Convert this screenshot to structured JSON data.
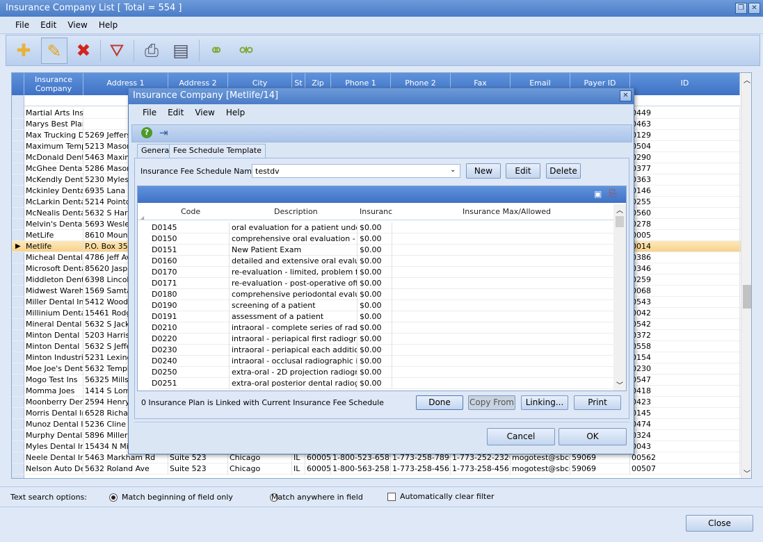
{
  "window": {
    "title": "Insurance Company List [ Total = 554 ]",
    "restore_icon": "restore-icon",
    "close_icon": "close-icon"
  },
  "menu": [
    "File",
    "Edit",
    "View",
    "Help"
  ],
  "toolbar": {
    "icons": [
      "add-icon",
      "edit-icon",
      "delete-icon",
      "clear-filter-icon",
      "print-icon",
      "print-list-icon",
      "link-icon",
      "unlink-icon"
    ]
  },
  "grid": {
    "columns": [
      "Insurance Company",
      "Address 1",
      "Address 2",
      "City",
      "St",
      "Zip",
      "Phone 1",
      "Phone 2",
      "Fax",
      "Email",
      "Payer ID",
      "ID"
    ],
    "rows": [
      {
        "name": "Martial Arts Ins",
        "addr": "",
        "id": "0449"
      },
      {
        "name": "Marys Best Plan",
        "addr": "",
        "id": "0463"
      },
      {
        "name": "Max Trucking D",
        "addr": "5269 Jeffers",
        "id": "0129"
      },
      {
        "name": "Maximum Temp",
        "addr": "5213 Mason",
        "id": "0504"
      },
      {
        "name": "McDonald Dent",
        "addr": "5463 Maxine",
        "id": "0290"
      },
      {
        "name": "McGhee Dental",
        "addr": "5286 Mason",
        "id": "0377"
      },
      {
        "name": "McKendly Denta",
        "addr": "5230 Myles",
        "id": "0363"
      },
      {
        "name": "Mckinley Dental",
        "addr": "6935 Lana A",
        "id": "0146"
      },
      {
        "name": "McLarkin Dental",
        "addr": "5214 Pointd",
        "id": "0255"
      },
      {
        "name": "McNealis Dental",
        "addr": "5632 S Harri",
        "id": "0560"
      },
      {
        "name": "Melvin's Dental",
        "addr": "5693 Wesley",
        "id": "0278"
      },
      {
        "name": "MetLife",
        "addr": "8610 Mounti",
        "id": "0005"
      },
      {
        "name": "Metlife",
        "addr": "P.O. Box 350",
        "id": "0014"
      },
      {
        "name": "Micheal Dental I",
        "addr": "4786 Jeff Av",
        "id": "0386"
      },
      {
        "name": "Microsoft Dental",
        "addr": "85620 Jaspe",
        "id": "0346"
      },
      {
        "name": "Middleton Dent",
        "addr": "6398 Lincoln",
        "id": "0259"
      },
      {
        "name": "Midwest Wareh",
        "addr": "1569 Samtag",
        "id": "0068"
      },
      {
        "name": "Miller Dental In",
        "addr": "5412 Woods",
        "id": "0543"
      },
      {
        "name": "Millinium Dental",
        "addr": "15461 Rodg",
        "id": "0042"
      },
      {
        "name": "Mineral Dental I",
        "addr": "5632 S Jacks",
        "id": "0542"
      },
      {
        "name": "Minton Dental I",
        "addr": "5203 Harris",
        "id": "0372"
      },
      {
        "name": "Minton Dental I",
        "addr": "5632 S Jeffe",
        "id": "0558"
      },
      {
        "name": "Minton Industri",
        "addr": "5231 Lexing",
        "id": "0154"
      },
      {
        "name": "Moe Joe's Dent",
        "addr": "5632 Temple",
        "id": "0230"
      },
      {
        "name": "Mogo Test Ins",
        "addr": "56325 Millsi",
        "id": "0547"
      },
      {
        "name": "Momma Joes",
        "addr": "1414 S Lomb",
        "id": "0418"
      },
      {
        "name": "Moonberry Dent",
        "addr": "2594 Henry",
        "id": "0423"
      },
      {
        "name": "Morris Dental In",
        "addr": "6528 Richard",
        "id": "0145"
      },
      {
        "name": "Munoz Dental I",
        "addr": "5236 Cline A",
        "id": "0474"
      },
      {
        "name": "Murphy Dental I",
        "addr": "5896 Miller A",
        "id": "0324"
      },
      {
        "name": "Myles Dental In",
        "addr": "15434 N Mic",
        "id": "0043"
      }
    ],
    "full_rows": [
      {
        "name": "Neele Dental In",
        "addr1": "5463 Markham Rd",
        "addr2": "Suite 523",
        "city": "Chicago",
        "st": "IL",
        "zip": "60005",
        "phone1": "1-800-523-6589",
        "phone2": "1-773-258-7896",
        "fax": "1-773-252-2320",
        "email": "mogotest@sbcg",
        "payer": "59069",
        "id": "00562"
      },
      {
        "name": "Nelson Auto De",
        "addr1": "5632 Roland Ave",
        "addr2": "Suite 523",
        "city": "Chicago",
        "st": "IL",
        "zip": "60005",
        "phone1": "1-800-563-2587",
        "phone2": "1-773-258-4563",
        "fax": "1-773-258-4561",
        "email": "mogotest@sbcg",
        "payer": "59069",
        "id": "00507"
      }
    ]
  },
  "search": {
    "label": "Text search options:",
    "opt1": "Match beginning of field only",
    "opt2": "Match anywhere in field",
    "opt3": "Automatically clear filter"
  },
  "close_button": "Close",
  "dialog": {
    "title": "Insurance Company [Metlife/14]",
    "menu": [
      "File",
      "Edit",
      "View",
      "Help"
    ],
    "tabs": [
      "General",
      "Fee Schedule Template"
    ],
    "fee_label": "Insurance Fee Schedule Name:",
    "fee_value": "testdv",
    "btn_new": "New",
    "btn_edit": "Edit",
    "btn_delete": "Delete",
    "columns": [
      "Code",
      "Description",
      "Insuranc",
      "Insurance Max/Allowed"
    ],
    "rows": [
      {
        "code": "D0145",
        "desc": "oral evaluation for a patient under",
        "amt": "$0.00"
      },
      {
        "code": "D0150",
        "desc": "comprehensive oral evaluation - ne",
        "amt": "$0.00"
      },
      {
        "code": "D0151",
        "desc": "New Patient Exam",
        "amt": "$0.00"
      },
      {
        "code": "D0160",
        "desc": "detailed and extensive oral evaluati",
        "amt": "$0.00"
      },
      {
        "code": "D0170",
        "desc": "re-evaluation - limited, problem foc",
        "amt": "$0.00"
      },
      {
        "code": "D0171",
        "desc": "re-evaluation - post-operative offic",
        "amt": "$0.00"
      },
      {
        "code": "D0180",
        "desc": "comprehensive periodontal evaluati",
        "amt": "$0.00"
      },
      {
        "code": "D0190",
        "desc": "screening of a patient",
        "amt": "$0.00"
      },
      {
        "code": "D0191",
        "desc": "assessment of a patient",
        "amt": "$0.00"
      },
      {
        "code": "D0210",
        "desc": "intraoral - complete series of radio",
        "amt": "$0.00"
      },
      {
        "code": "D0220",
        "desc": "intraoral - periapical first radiograp",
        "amt": "$0.00"
      },
      {
        "code": "D0230",
        "desc": "intraoral - periapical each additiona",
        "amt": "$0.00"
      },
      {
        "code": "D0240",
        "desc": "intraoral - occlusal radiographic im",
        "amt": "$0.00"
      },
      {
        "code": "D0250",
        "desc": "extra-oral - 2D projection radiograp",
        "amt": "$0.00"
      },
      {
        "code": "D0251",
        "desc": "extra-oral posterior dental radiogra",
        "amt": "$0.00"
      }
    ],
    "status": "0 Insurance Plan is Linked with Current Insurance Fee Schedule",
    "btn_done": "Done",
    "btn_copy": "Copy From",
    "btn_linking": "Linking...",
    "btn_print": "Print",
    "btn_cancel": "Cancel",
    "btn_ok": "OK"
  }
}
